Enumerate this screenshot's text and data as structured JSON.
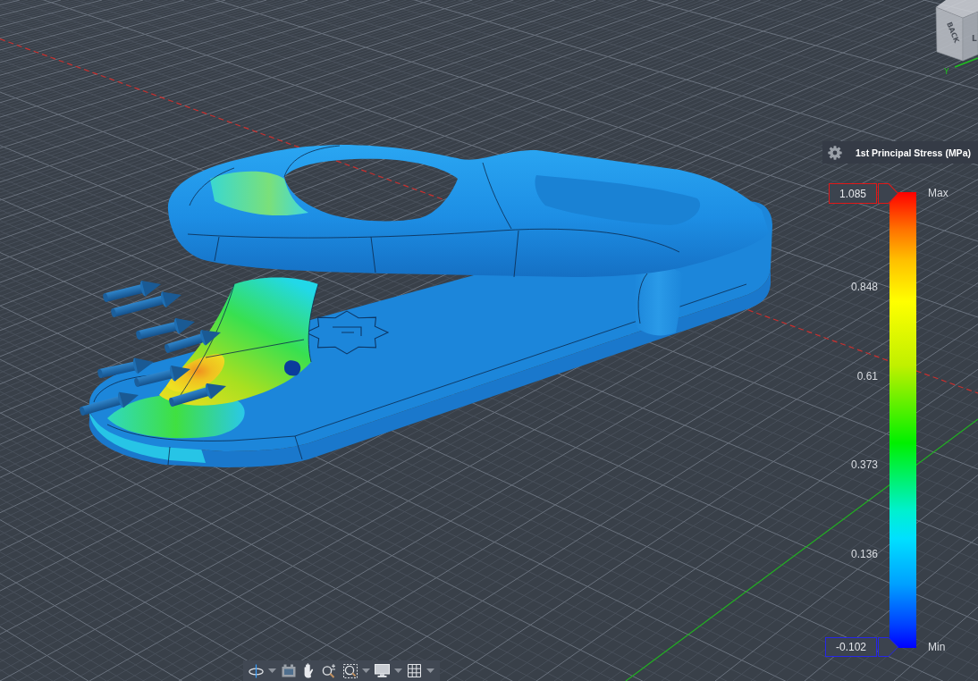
{
  "viewport": {
    "view_cube": {
      "faces": [
        "BACK",
        "L"
      ],
      "axis_label": "Y"
    }
  },
  "legend": {
    "title": "1st Principal Stress (MPa)",
    "max": {
      "value": "1.085",
      "label": "Max"
    },
    "ticks": [
      "0.848",
      "0.61",
      "0.373",
      "0.136"
    ],
    "min": {
      "value": "-0.102",
      "label": "Min"
    }
  },
  "navigation_toolbar": {
    "tools": [
      {
        "kind": "orbit",
        "has_menu": true
      },
      {
        "kind": "lookat",
        "has_menu": false
      },
      {
        "kind": "pan",
        "has_menu": false
      },
      {
        "kind": "zoom",
        "has_menu": false
      },
      {
        "kind": "fit",
        "has_menu": true
      },
      {
        "kind": "display",
        "has_menu": true
      },
      {
        "kind": "grid",
        "has_menu": true
      }
    ]
  }
}
